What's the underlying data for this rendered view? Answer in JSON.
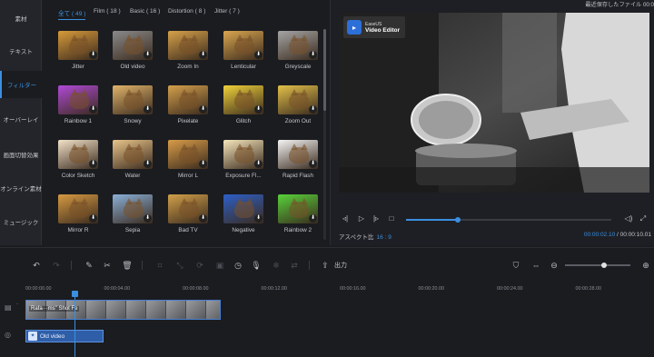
{
  "sidebar": {
    "items": [
      {
        "label": "素材",
        "active": false
      },
      {
        "label": "テキスト",
        "active": false
      },
      {
        "label": "フィルター",
        "active": true
      },
      {
        "label": "オーバーレイ",
        "active": false
      },
      {
        "label": "画面切替効果",
        "active": false
      },
      {
        "label": "オンライン素材",
        "active": false
      },
      {
        "label": "ミュージック",
        "active": false
      }
    ]
  },
  "categories": [
    {
      "label": "全て ( 49 )",
      "active": true
    },
    {
      "label": "Film ( 18 )",
      "active": false
    },
    {
      "label": "Basic ( 16 )",
      "active": false
    },
    {
      "label": "Distortion ( 8 )",
      "active": false
    },
    {
      "label": "Jitter ( 7 )",
      "active": false
    }
  ],
  "filters": [
    {
      "label": "Jitter",
      "color": "#d79a3a"
    },
    {
      "label": "Old video",
      "color": "#8a8a8a"
    },
    {
      "label": "Zoom In",
      "color": "#d7a24a"
    },
    {
      "label": "Lenticular",
      "color": "#d9a64f"
    },
    {
      "label": "Greyscale",
      "color": "#a5a5a5"
    },
    {
      "label": "Rainbow 1",
      "color": "#b04ad6"
    },
    {
      "label": "Snowy",
      "color": "#e0b46a"
    },
    {
      "label": "Pixelate",
      "color": "#d4a04c"
    },
    {
      "label": "Glitch",
      "color": "#f0d23a"
    },
    {
      "label": "Zoom Out",
      "color": "#e3c14a"
    },
    {
      "label": "Color Sketch",
      "color": "#f2e2c8"
    },
    {
      "label": "Water",
      "color": "#e8c48a"
    },
    {
      "label": "Mirror L",
      "color": "#d89c48"
    },
    {
      "label": "Exposure Fl...",
      "color": "#f6e6bc"
    },
    {
      "label": "Rapid Flash",
      "color": "#f4f4f4"
    },
    {
      "label": "Mirror R",
      "color": "#d79a42"
    },
    {
      "label": "Sepia",
      "color": "#8ab0d8"
    },
    {
      "label": "Bad TV",
      "color": "#d2a04a"
    },
    {
      "label": "Negative",
      "color": "#2d5fc8"
    },
    {
      "label": "Rainbow 2",
      "color": "#58d23a"
    }
  ],
  "preview": {
    "autosave": "最近保存したファイル 00:0",
    "watermark_brand": "EaseUS",
    "watermark_product": "Video Editor",
    "aspect_label": "アスペクト比",
    "aspect_value": "16 : 9",
    "current_time": "00:00:02.10",
    "separator": "/",
    "total_time": "00:00:10.01",
    "playback_progress": 0.25
  },
  "toolbar": {
    "export_label": "出力",
    "zoom_level": 0.6
  },
  "timeline": {
    "ruler": [
      "00:00:00.00",
      "00:00:04.00",
      "00:00:08.00",
      "00:00:12.00",
      "00:00:16.00",
      "00:00:20.00",
      "00:00:24.00",
      "00:00:28.00"
    ],
    "video_clip_label": "Rafa···ms\" Shot Fe",
    "filter_clip_label": "Old video"
  },
  "colors": {
    "accent": "#3a8fe0",
    "background": "#1b1c20"
  }
}
